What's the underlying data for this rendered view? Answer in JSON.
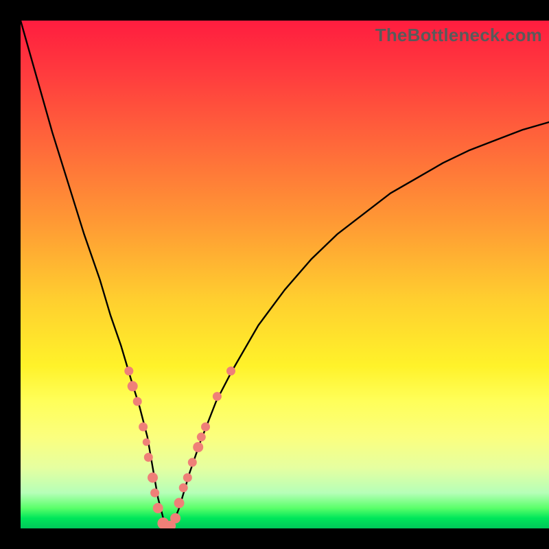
{
  "brand": "TheBottleneck.com",
  "colors": {
    "curve": "#000000",
    "marker_fill": "#ef8078",
    "marker_stroke": "#ef8078",
    "frame": "#000000"
  },
  "chart_data": {
    "type": "line",
    "title": "",
    "xlabel": "",
    "ylabel": "",
    "xlim": [
      0,
      100
    ],
    "ylim": [
      0,
      100
    ],
    "series": [
      {
        "name": "bottleneck-curve",
        "x": [
          0,
          3,
          6,
          9,
          12,
          15,
          17,
          19,
          21,
          22.5,
          24,
          25,
          26,
          27,
          27.5,
          28.5,
          30,
          32,
          34,
          37,
          40,
          45,
          50,
          55,
          60,
          65,
          70,
          75,
          80,
          85,
          90,
          95,
          100
        ],
        "y": [
          100,
          89,
          78,
          68,
          58,
          49,
          42,
          36,
          29,
          24,
          18,
          12,
          6,
          2,
          0,
          0,
          4,
          11,
          17,
          25,
          31,
          40,
          47,
          53,
          58,
          62,
          66,
          69,
          72,
          74.5,
          76.5,
          78.5,
          80
        ]
      }
    ],
    "markers": [
      {
        "x": 20.5,
        "y": 31,
        "r": 6
      },
      {
        "x": 21.2,
        "y": 28,
        "r": 7
      },
      {
        "x": 22.1,
        "y": 25,
        "r": 6
      },
      {
        "x": 23.2,
        "y": 20,
        "r": 6
      },
      {
        "x": 23.8,
        "y": 17,
        "r": 5
      },
      {
        "x": 24.2,
        "y": 14,
        "r": 6
      },
      {
        "x": 25.0,
        "y": 10,
        "r": 7
      },
      {
        "x": 25.4,
        "y": 7,
        "r": 6
      },
      {
        "x": 26.0,
        "y": 4,
        "r": 7
      },
      {
        "x": 27.0,
        "y": 1,
        "r": 8
      },
      {
        "x": 27.6,
        "y": 0,
        "r": 7
      },
      {
        "x": 28.4,
        "y": 0.5,
        "r": 7
      },
      {
        "x": 29.3,
        "y": 2,
        "r": 7
      },
      {
        "x": 30.0,
        "y": 5,
        "r": 7
      },
      {
        "x": 30.8,
        "y": 8,
        "r": 6
      },
      {
        "x": 31.6,
        "y": 10,
        "r": 6
      },
      {
        "x": 32.5,
        "y": 13,
        "r": 6
      },
      {
        "x": 33.6,
        "y": 16,
        "r": 7
      },
      {
        "x": 34.2,
        "y": 18,
        "r": 6
      },
      {
        "x": 35.0,
        "y": 20,
        "r": 6
      },
      {
        "x": 37.2,
        "y": 26,
        "r": 6
      },
      {
        "x": 39.8,
        "y": 31,
        "r": 6
      }
    ]
  }
}
